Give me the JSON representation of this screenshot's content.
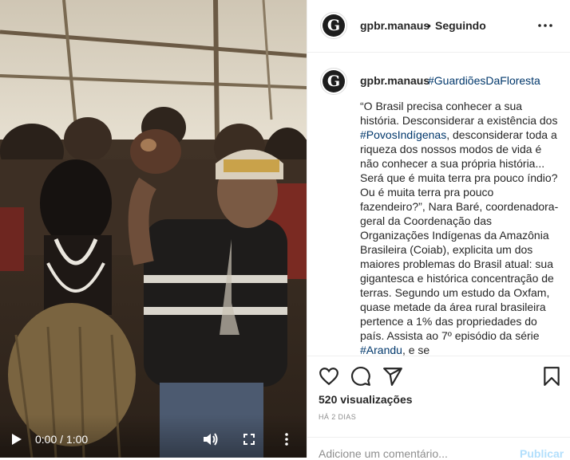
{
  "video": {
    "time": "0:00 / 1:00",
    "play_icon": "play-icon",
    "volume_icon": "volume-icon",
    "fullscreen_icon": "fullscreen-icon",
    "menu_icon": "more-vertical-icon"
  },
  "header": {
    "username": "gpbr.manaus",
    "separator": "•",
    "follow_status": "Seguindo",
    "avatar_letter": "G"
  },
  "post": {
    "username": "gpbr.manaus",
    "hashtag": "#GuardiõesDaFloresta",
    "caption": {
      "part1": "“O Brasil precisa conhecer a sua história. Desconsiderar a existência dos ",
      "tag1": "#PovosIndígenas",
      "part2": ", desconsiderar toda a riqueza dos nossos modos de vida é não conhecer a sua própria história... Será que é muita terra pra pouco índio? Ou é muita terra pra pouco fazendeiro?”, Nara Baré, coordenadora-geral da Coordenação das Organizações Indígenas da Amazônia Brasileira (Coiab), explicita um dos maiores problemas do Brasil atual: sua gigantesca e histórica concentração de terras. Segundo um estudo da Oxfam, quase metade da área rural brasileira pertence a 1% das propriedades do país. Assista ao 7º episódio da série ",
      "tag2": "#Arandu",
      "part3": ", e se"
    }
  },
  "actions": {
    "views": "520 visualizações",
    "time_ago": "HÁ 2 DIAS",
    "comment_placeholder": "Adicione um comentário...",
    "publish_label": "Publicar"
  },
  "colors": {
    "link": "#00376b",
    "publish_disabled": "#b2dffc",
    "muted": "#8e8e8e",
    "border": "#efefef"
  }
}
